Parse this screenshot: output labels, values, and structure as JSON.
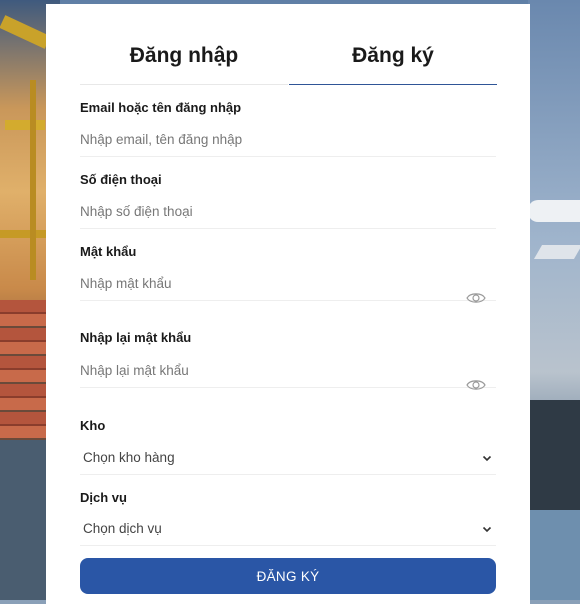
{
  "tabs": {
    "login": "Đăng nhập",
    "register": "Đăng ký"
  },
  "form": {
    "email": {
      "label": "Email hoặc tên đăng nhập",
      "placeholder": "Nhập email, tên đăng nhập"
    },
    "phone": {
      "label": "Số điện thoại",
      "placeholder": "Nhập số điện thoại"
    },
    "password": {
      "label": "Mật khẩu",
      "placeholder": "Nhập mật khẩu",
      "icon": "eye-icon"
    },
    "confirm_password": {
      "label": "Nhập lại mật khẩu",
      "placeholder": "Nhập lại mật khẩu",
      "icon": "eye-icon"
    },
    "warehouse": {
      "label": "Kho",
      "selected": "Chọn kho hàng",
      "icon": "chevron-down-icon"
    },
    "service": {
      "label": "Dịch vụ",
      "selected": "Chọn dịch vụ",
      "icon": "chevron-down-icon"
    },
    "submit_label": "ĐĂNG KÝ"
  },
  "colors": {
    "accent": "#2a56a6",
    "tab_underline": "#2f5597"
  }
}
